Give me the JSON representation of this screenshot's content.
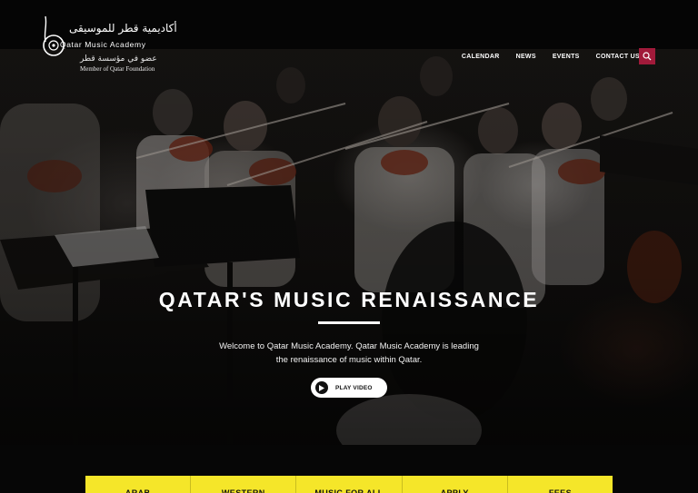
{
  "brand": {
    "arabic_name": "أكاديمية قطر للموسيقى",
    "english_name": "Qatar Music Academy",
    "member_arabic": "عضو في مؤسسة قطر",
    "member_english": "Member of Qatar Foundation"
  },
  "nav": {
    "items": [
      {
        "label": "CALENDAR"
      },
      {
        "label": "NEWS"
      },
      {
        "label": "EVENTS"
      },
      {
        "label": "CONTACT US"
      }
    ],
    "search_icon": "search-icon",
    "accent_color": "#a11a3a"
  },
  "hero": {
    "title": "QATAR'S MUSIC RENAISSANCE",
    "description": "Welcome to Qatar Music Academy. Qatar Music Academy is leading the renaissance of music within Qatar.",
    "play_button_label": "PLAY VIDEO"
  },
  "tabs": {
    "color": "#f5e629",
    "items": [
      {
        "label": "ARAB"
      },
      {
        "label": "WESTERN"
      },
      {
        "label": "MUSIC FOR ALL"
      },
      {
        "label": "APPLY"
      },
      {
        "label": "FEES"
      }
    ]
  }
}
